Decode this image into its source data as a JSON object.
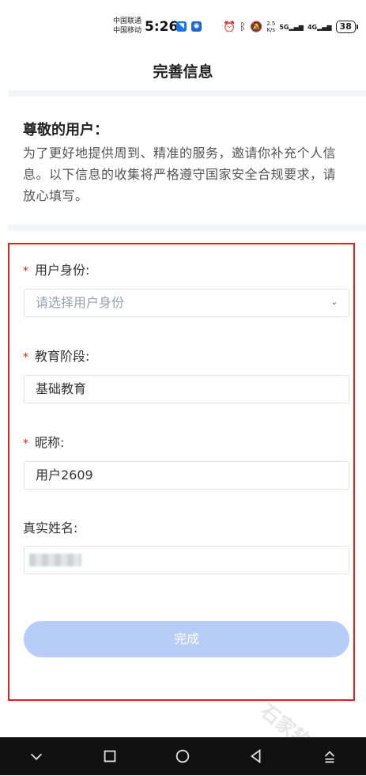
{
  "status_bar": {
    "carrier_1": "中国联通",
    "carrier_2": "中国移动",
    "time": "5:26",
    "net_speed_value": "2.5",
    "net_speed_unit": "K/s",
    "signal_1": "5G",
    "signal_2": "4G",
    "battery": "38"
  },
  "header": {
    "title": "完善信息"
  },
  "intro": {
    "greeting": "尊敬的用户：",
    "text": "为了更好地提供周到、精准的服务，邀请你补充个人信息。以下信息的收集将严格遵守国家安全合规要求，请放心填写。"
  },
  "form": {
    "required_mark": "*",
    "user_identity": {
      "label": "用户身份:",
      "placeholder": "请选择用户身份",
      "required": true
    },
    "education_stage": {
      "label": "教育阶段:",
      "value": "基础教育",
      "required": true
    },
    "nickname": {
      "label": "昵称:",
      "value": "用户2609",
      "required": true
    },
    "real_name": {
      "label": "真实姓名:",
      "required": false
    },
    "submit_label": "完成"
  },
  "watermark": "石家软件站",
  "colors": {
    "required": "#e02020",
    "button_disabled": "#b7ccf7",
    "highlight_frame": "#e02020"
  }
}
